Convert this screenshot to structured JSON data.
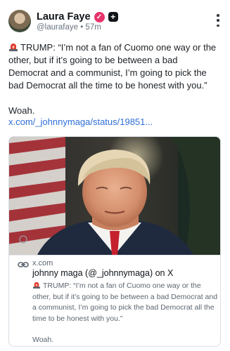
{
  "author": {
    "name": "Laura Faye",
    "handle": "@laurafaye",
    "time": "57m",
    "verified_icon": "verified-check-icon",
    "badge_icon": "plus-badge-icon",
    "verified_color": "#e8336b"
  },
  "post": {
    "quote": "TRUMP: “I’m not a fan of Cuomo one way or the other, but if it’s going to be between a bad Democrat and a communist, I’m going to pick the bad Democrat all the time to be honest with you.”",
    "reaction": "Woah.",
    "link_text": "x.com/_johnnymaga/status/19851...",
    "link_color": "#2f6fd8"
  },
  "card": {
    "domain": "x.com",
    "title": "johnny maga (@_johnnymaga) on X",
    "description": "TRUMP: “I’m not a fan of Cuomo one way or the other, but if it’s going to be between a bad Democrat and a communist, I’m going to pick the bad Democrat all the time to be honest with you.”",
    "reaction": "Woah.",
    "link_icon": "link-chain-icon",
    "image_icon": "interview-photo"
  },
  "icons": {
    "siren": "siren-emoji-icon",
    "more": "more-options-icon"
  }
}
